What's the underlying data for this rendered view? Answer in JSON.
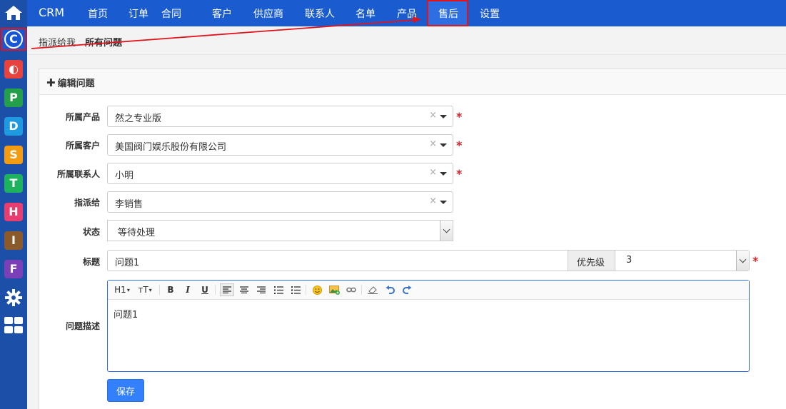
{
  "topbar": {
    "brand": "CRM",
    "nav": [
      "首页",
      "订单",
      "合同",
      "客户",
      "供应商",
      "联系人",
      "名单",
      "产品",
      "售后",
      "设置"
    ],
    "active_nav": "售后"
  },
  "sidebar": {
    "apps": [
      {
        "letter": "C",
        "color": "#1557d6"
      },
      {
        "letter": "◐",
        "color": "#e8423e"
      },
      {
        "letter": "P",
        "color": "#25a04a"
      },
      {
        "letter": "D",
        "color": "#1e9be0"
      },
      {
        "letter": "S",
        "color": "#f39c12"
      },
      {
        "letter": "T",
        "color": "#1db25d"
      },
      {
        "letter": "H",
        "color": "#e83d6f"
      },
      {
        "letter": "I",
        "color": "#8a5a2b"
      },
      {
        "letter": "F",
        "color": "#7b3fb8"
      }
    ]
  },
  "subnav": {
    "items": [
      "指派给我",
      "所有问题"
    ]
  },
  "panel": {
    "title": "编辑问题",
    "fields": {
      "product": {
        "label": "所属产品",
        "value": "然之专业版"
      },
      "customer": {
        "label": "所属客户",
        "value": "美国阀门娱乐股份有限公司"
      },
      "contact": {
        "label": "所属联系人",
        "value": "小明"
      },
      "assignee": {
        "label": "指派给",
        "value": "李销售"
      },
      "status": {
        "label": "状态",
        "value": "等待处理"
      },
      "title": {
        "label": "标题",
        "value": "问题1",
        "priority_label": "优先级",
        "priority_value": "3"
      },
      "desc": {
        "label": "问题描述",
        "value": "问题1"
      }
    },
    "toolbar": {
      "h1": "H1",
      "tt": "тT",
      "bold": "B",
      "italic": "I",
      "underline": "U"
    },
    "save_label": "保存",
    "required_mark": "*",
    "clear_mark": "×"
  }
}
